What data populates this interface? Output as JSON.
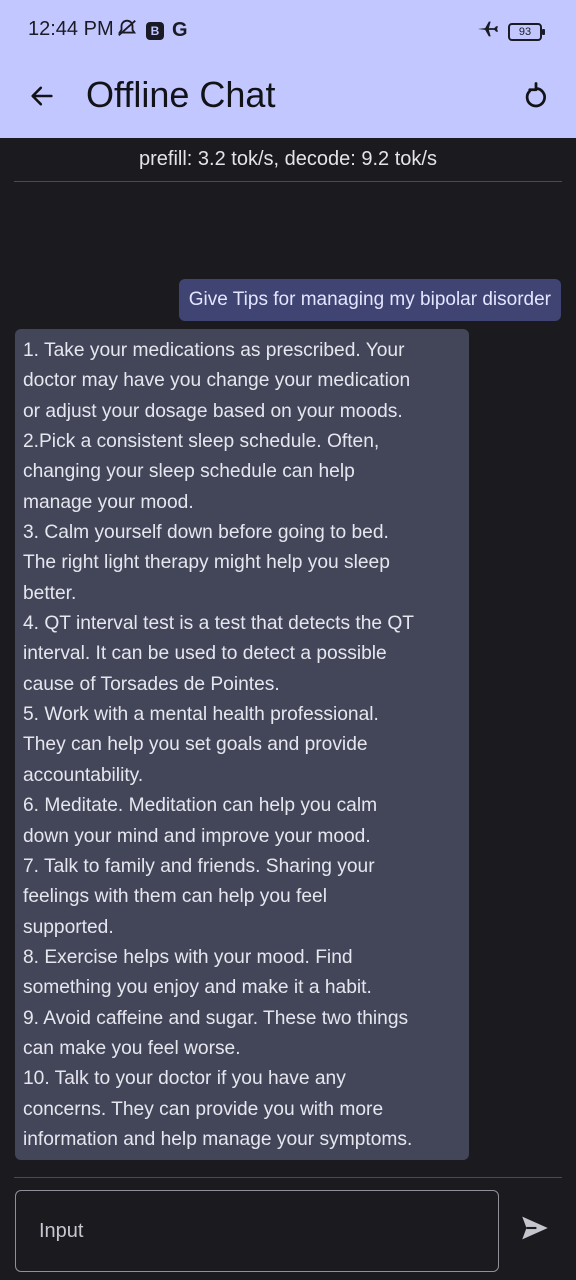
{
  "status_bar": {
    "time": "12:44 PM",
    "badge_b": "B",
    "badge_g": "G",
    "battery": "93",
    "icons": [
      "muted-alarm-icon",
      "b-badge-icon",
      "google-icon",
      "airplane-mode-icon",
      "battery-icon"
    ]
  },
  "appbar": {
    "title": "Offline Chat",
    "back_icon": "arrow-left-icon",
    "reset_icon": "refresh-icon",
    "background": "#c3c7ff"
  },
  "stats": {
    "text": "prefill: 3.2 tok/s, decode: 9.2 tok/s"
  },
  "messages": {
    "user": "Give Tips for managing my bipolar disorder",
    "bot_lines": [
      "1. Take your medications as prescribed. Your",
      "doctor may have you change your medication",
      "or adjust your dosage based on your moods.",
      "2.Pick a consistent sleep schedule.  Often,",
      "changing your sleep schedule can help",
      "manage your mood.",
      "3. Calm yourself down before going to bed.",
      "The right light therapy might help you sleep",
      "better.",
      "4. QT interval test is a test that detects the QT",
      "interval. It can be used to detect a possible",
      "cause of Torsades de Pointes.",
      "5. Work with a mental health professional.",
      "They can help you set goals and provide",
      "accountability.",
      "6. Meditate. Meditation can help you calm",
      "down your mind and improve your mood.",
      "7. Talk to family and friends. Sharing your",
      "feelings with them can help you feel",
      "supported.",
      "8. Exercise helps with your mood. Find",
      "something you enjoy and make it a habit.",
      "9. Avoid caffeine and sugar. These two things",
      "can make you feel worse.",
      "10. Talk to your doctor if you have any",
      "concerns. They can provide you with more",
      "information and help manage your symptoms."
    ]
  },
  "composer": {
    "placeholder": "Input",
    "value": "",
    "send_icon": "send-icon"
  },
  "colors": {
    "background": "#1b1b1f",
    "user_bubble": "#3f4473",
    "bot_bubble": "#434659"
  }
}
